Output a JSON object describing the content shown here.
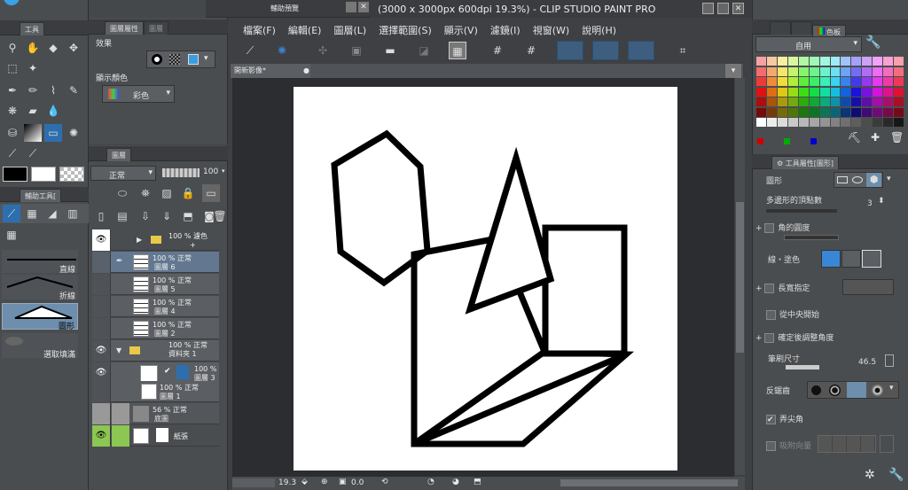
{
  "title": "(3000 x 3000px 600dpi 19.3%) - CLIP STUDIO PAINT PRO",
  "nav_title": "輔助預覽",
  "menu": [
    "檔案(F)",
    "編輯(E)",
    "圖層(L)",
    "選擇範圍(S)",
    "顯示(V)",
    "濾鏡(I)",
    "視窗(W)",
    "說明(H)"
  ],
  "doc_tab": "開新影像*",
  "left": {
    "tools_tab": "工具",
    "subtool_tab": "輔助工具[",
    "subtools": [
      "直線",
      "折線",
      "圖形",
      "選取填滿"
    ],
    "layer_prop_tabs": [
      "圖層屬性",
      "圖層"
    ],
    "effect_label": "效果",
    "display_color_label": "顯示顏色",
    "display_color_value": "彩色",
    "layers_tab": "圖層",
    "blend_mode": "正常",
    "opacity": "100",
    "layers": [
      {
        "l1": "100 % 濾色",
        "l2": "+"
      },
      {
        "l1": "100 % 正常",
        "l2": "圖層 6"
      },
      {
        "l1": "100 % 正常",
        "l2": "圖層 5"
      },
      {
        "l1": "100 % 正常",
        "l2": "圖層 4"
      },
      {
        "l1": "100 % 正常",
        "l2": "圖層 2"
      },
      {
        "l1": "100 % 正常",
        "l2": "資料夾 1"
      },
      {
        "l1": "100 %",
        "l2": "圖層 3"
      },
      {
        "l1": "100 % 正常",
        "l2": "圖層 1"
      },
      {
        "l1": "56 % 正常",
        "l2": "底圖"
      },
      {
        "l1": "紙張",
        "l2": ""
      }
    ]
  },
  "right": {
    "color_tab": "色板",
    "palette_select": "自用",
    "tool_prop_tab": "工具屬性[圖形]",
    "shape_label": "圖形",
    "vertices_label": "多邊形的頂點數",
    "vertices_value": "3",
    "corner_round": "角的圓度",
    "line_fill": "線・塗色",
    "aspect": "長寬指定",
    "from_center": "從中央開始",
    "adjust_angle": "確定後調整角度",
    "brush_size_label": "筆刷尺寸",
    "brush_size_value": "46.5",
    "anti_alias": "反鋸齒",
    "sharp_corner": "弄尖角",
    "snap_vector": "吸附向量"
  },
  "status": {
    "zoom": "19.3",
    "angle": "0.0"
  },
  "accent": "#2d6fae"
}
